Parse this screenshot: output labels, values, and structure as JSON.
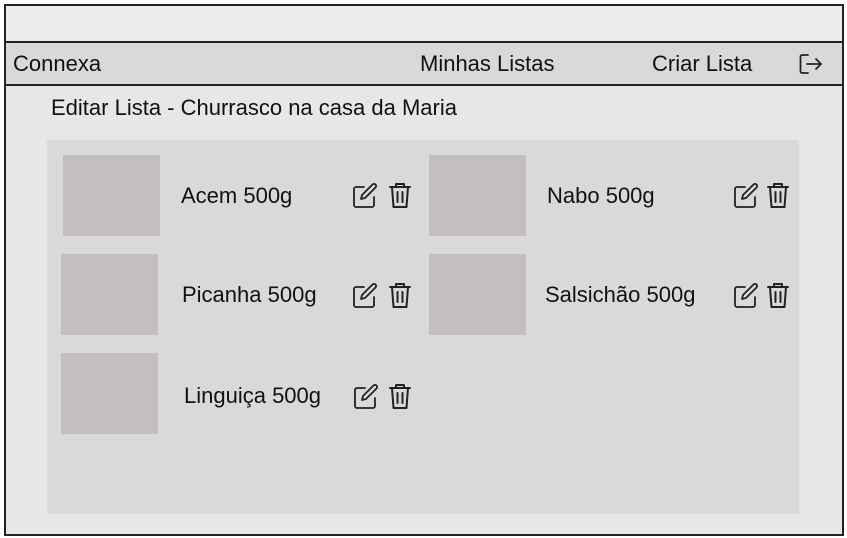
{
  "navbar": {
    "brand": "Connexa",
    "links": [
      "Minhas Listas",
      "Criar Lista"
    ],
    "logout_icon": "logout-icon"
  },
  "page": {
    "title": "Editar Lista - Churrasco na casa da Maria"
  },
  "items": [
    {
      "label": "Acem 500g"
    },
    {
      "label": "Nabo 500g"
    },
    {
      "label": "Picanha 500g"
    },
    {
      "label": "Salsichão 500g"
    },
    {
      "label": "Linguiça 500g"
    }
  ],
  "icons": {
    "edit": "edit-icon",
    "delete": "trash-icon"
  },
  "colors": {
    "background": "#e7e7e7",
    "navbar": "#d9d9d9",
    "panel": "#d9d9d9",
    "thumbnail": "#c3bfbf",
    "border": "#222222"
  }
}
